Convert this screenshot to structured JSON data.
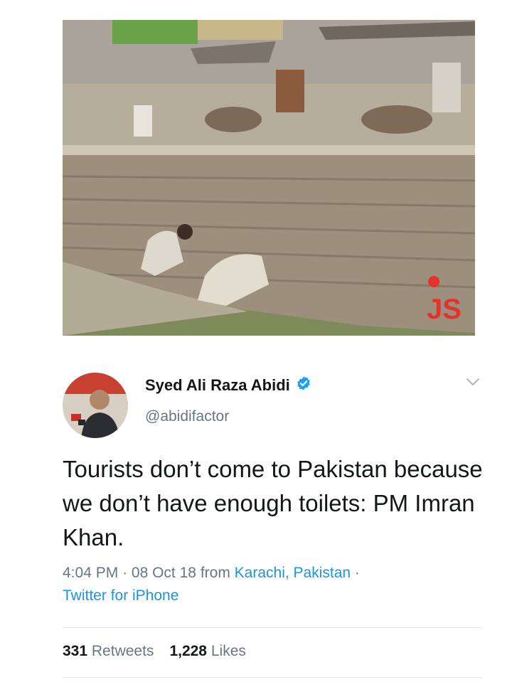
{
  "photo": {
    "watermark_logo": "JS"
  },
  "tweet": {
    "author": {
      "display_name": "Syed Ali Raza Abidi",
      "handle": "@abidifactor",
      "verified": true
    },
    "text": "Tourists don’t come to Pakistan because we don’t have enough toilets: PM Imran Khan.",
    "time": "4:04 PM",
    "separator": "·",
    "date": "08 Oct 18",
    "from_prefix": "from",
    "location": "Karachi, Pakistan",
    "source": "Twitter for iPhone",
    "retweets_count": "331",
    "retweets_label": "Retweets",
    "likes_count": "1,228",
    "likes_label": "Likes"
  },
  "icons": {
    "verified": "verified-badge-icon",
    "more": "chevron-down-icon"
  },
  "colors": {
    "link": "#1b95e0",
    "secondary_text": "#657786",
    "primary_text": "#14171a",
    "verified": "#1da1f2"
  }
}
